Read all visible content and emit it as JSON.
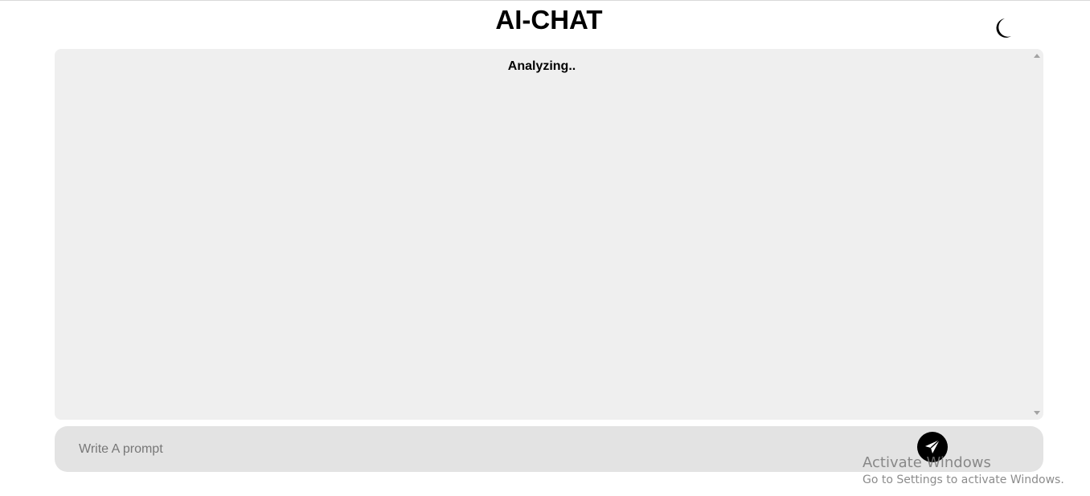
{
  "header": {
    "title": "AI-CHAT",
    "theme_toggle_icon": "moon-icon"
  },
  "chat": {
    "status": "Analyzing.."
  },
  "prompt": {
    "placeholder": "Write A prompt",
    "value": "",
    "send_icon": "paper-plane-icon"
  },
  "watermark": {
    "title": "Activate Windows",
    "subtitle": "Go to Settings to activate Windows."
  },
  "colors": {
    "chat_background": "#efefef",
    "prompt_background": "#e3e3e3",
    "send_button": "#000000"
  }
}
